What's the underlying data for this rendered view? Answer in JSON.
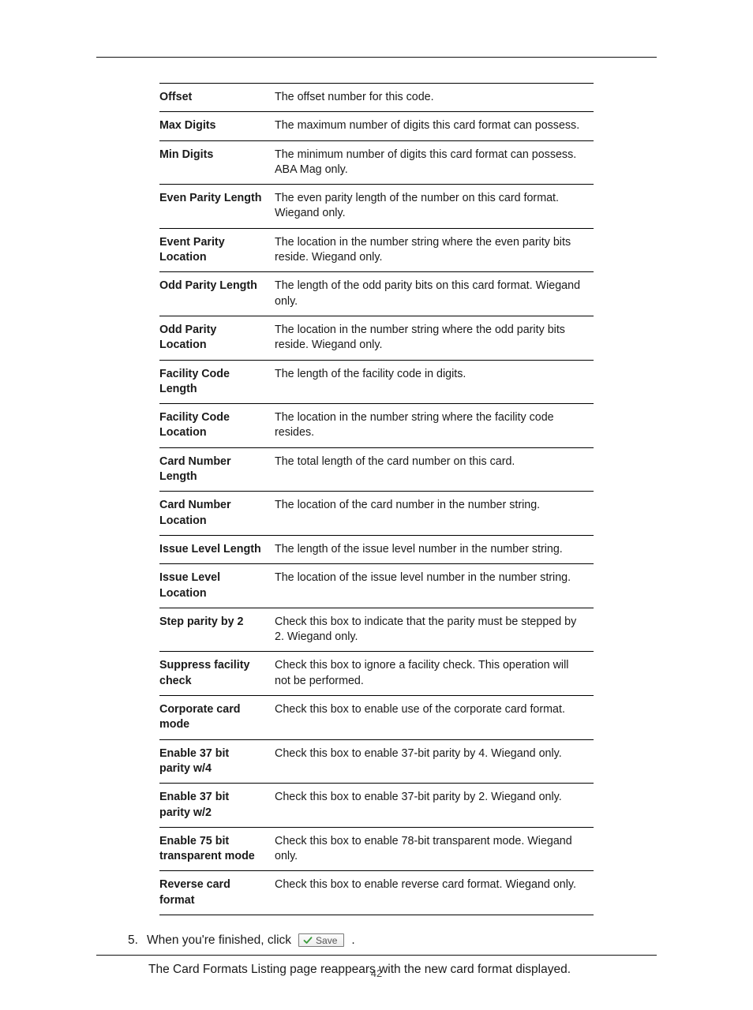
{
  "page_number": "42",
  "table_rows": [
    {
      "term": "Offset",
      "def": "The offset number for this code."
    },
    {
      "term": "Max Digits",
      "def": "The maximum number of digits this card format can possess."
    },
    {
      "term": "Min Digits",
      "def": "The minimum number of digits this card format can possess. ABA Mag only."
    },
    {
      "term": "Even Parity Length",
      "def": "The even parity length of the number on this card format. Wiegand only."
    },
    {
      "term": "Event Parity Location",
      "def": "The location in the number string where the even parity bits reside. Wiegand only."
    },
    {
      "term": "Odd Parity Length",
      "def": "The length of the odd parity bits on this card format. Wiegand only."
    },
    {
      "term": "Odd Parity Location",
      "def": "The location in the number string where the odd parity bits reside. Wiegand only."
    },
    {
      "term": "Facility Code Length",
      "def": "The length of the facility code in digits."
    },
    {
      "term": "Facility Code Location",
      "def": "The location in the number string where the facility code resides."
    },
    {
      "term": "Card Number Length",
      "def": "The total length of the card number on this card."
    },
    {
      "term": "Card Number Location",
      "def": "The location of the card number in the number string."
    },
    {
      "term": "Issue Level Length",
      "def": "The length of the issue level number in the number string."
    },
    {
      "term": "Issue Level Location",
      "def": "The location of the issue level number in the number string."
    },
    {
      "term": "Step parity by 2",
      "def": "Check this box to indicate that the parity must be stepped by 2. Wiegand only."
    },
    {
      "term": "Suppress facility check",
      "def": "Check this box to ignore a facility check. This operation will not be performed."
    },
    {
      "term": "Corporate card mode",
      "def": "Check this box to enable use of the corporate card format."
    },
    {
      "term": "Enable 37 bit parity w/4",
      "def": "Check this box to enable 37-bit parity by 4. Wiegand only."
    },
    {
      "term": "Enable 37 bit parity w/2",
      "def": "Check this box to enable 37-bit parity by 2. Wiegand only."
    },
    {
      "term": "Enable 75 bit transparent mode",
      "def": "Check this box to enable 78-bit transparent mode. Wiegand only."
    },
    {
      "term": "Reverse card format",
      "def": "Check this box to enable reverse card format. Wiegand only."
    }
  ],
  "step": {
    "number": "5.",
    "before": "When you're finished, click",
    "button_label": "Save",
    "after_period": "."
  },
  "followup": "The Card Formats Listing page reappears with the new card format displayed."
}
